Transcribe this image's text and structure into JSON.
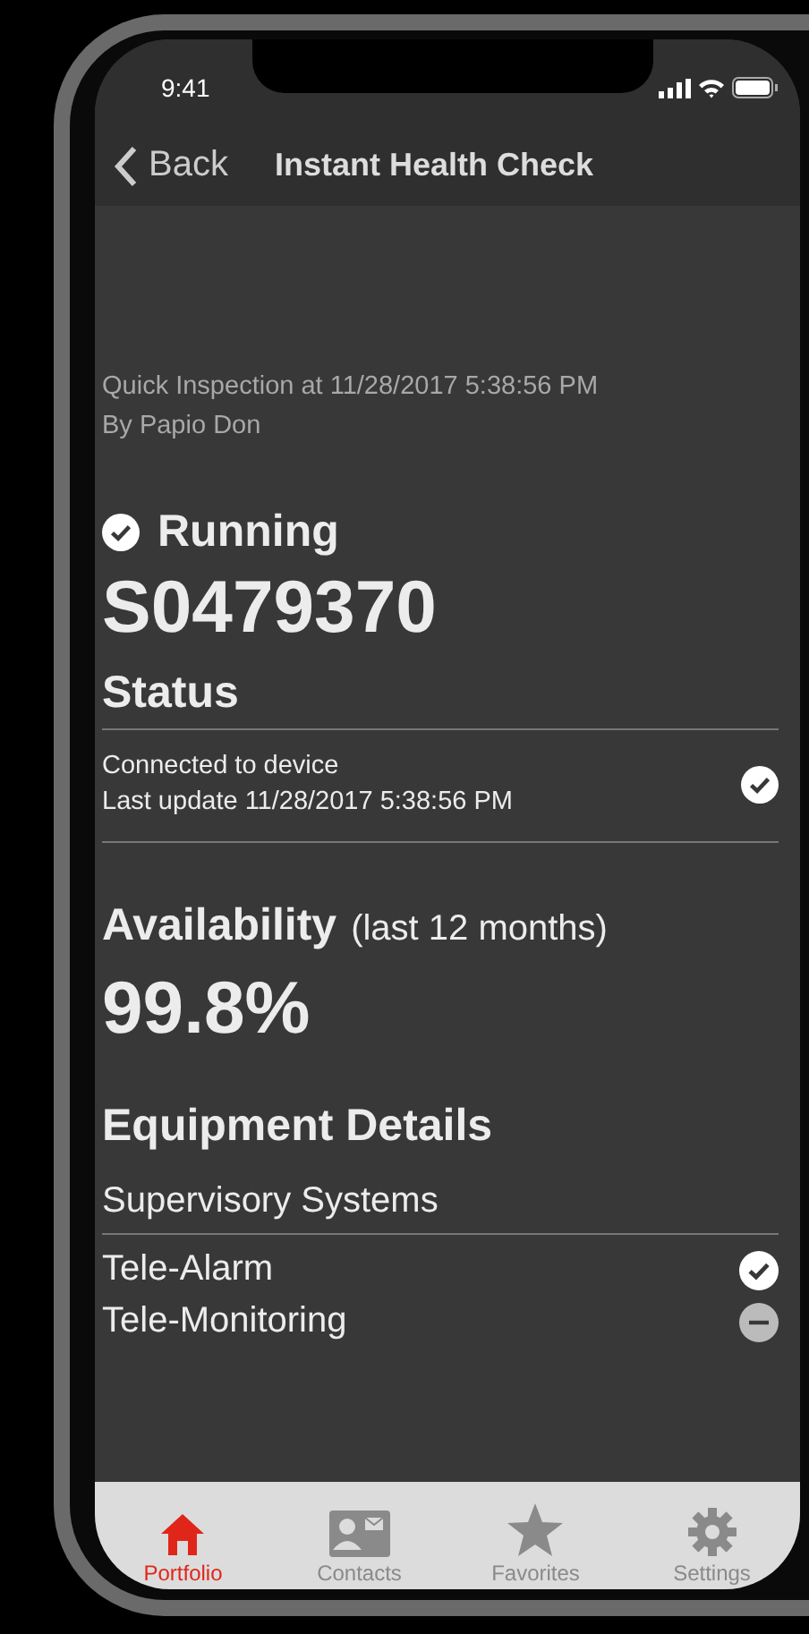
{
  "status_bar": {
    "time": "9:41"
  },
  "nav_bar": {
    "back": "Back",
    "title": "Instant Health Check"
  },
  "inspection": {
    "line_1": "Quick Inspection at 11/28/2017 5:38:56 PM",
    "line_2": "By Papio Don"
  },
  "state": {
    "label": "Running",
    "checked": true
  },
  "serial": "S0479370",
  "status": {
    "heading": "Status",
    "line_1": "Connected to device",
    "line_2": "Last update 11/28/2017 5:38:56 PM",
    "checked": true
  },
  "availability": {
    "heading": "Availability",
    "period": "(last 12 months)",
    "value": "99.8%"
  },
  "equipment": {
    "heading": "Equipment Details",
    "group": "Supervisory Systems",
    "items": [
      {
        "label": "Tele-Alarm",
        "kind": "ok"
      },
      {
        "label": "Tele-Monitoring",
        "kind": "partial"
      }
    ]
  },
  "tabs": [
    {
      "label": "Portfolio",
      "selected": true
    },
    {
      "label": "Contacts",
      "selected": false
    },
    {
      "label": "Favorites",
      "selected": false
    },
    {
      "label": "Settings",
      "selected": false
    }
  ]
}
